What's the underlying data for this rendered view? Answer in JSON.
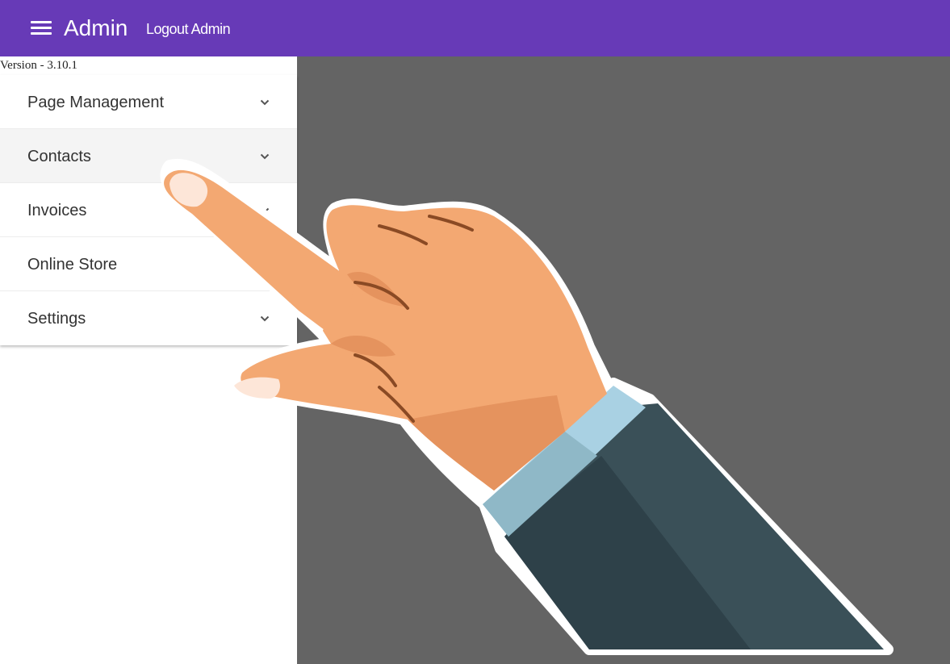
{
  "header": {
    "menu_icon": "hamburger-menu-icon",
    "title": "Admin",
    "logout_label": "Logout Admin",
    "color": "#673ab7"
  },
  "sidebar": {
    "version": "Version - 3.10.1",
    "items": [
      {
        "label": "Page Management",
        "expandable": true,
        "icon": "chevron-down-icon"
      },
      {
        "label": "Contacts",
        "expandable": true,
        "icon": "chevron-down-icon",
        "highlighted": true
      },
      {
        "label": "Invoices",
        "expandable": true,
        "icon": "chevron-down-icon"
      },
      {
        "label": "Online Store",
        "expandable": false
      },
      {
        "label": "Settings",
        "expandable": true,
        "icon": "chevron-down-icon"
      }
    ]
  },
  "overlay": {
    "icon": "pointing-hand-icon"
  },
  "colors": {
    "main_background": "#646464",
    "skin": "#f3a872",
    "sleeve": "#3a5058",
    "cuff": "#a9d1e3"
  }
}
